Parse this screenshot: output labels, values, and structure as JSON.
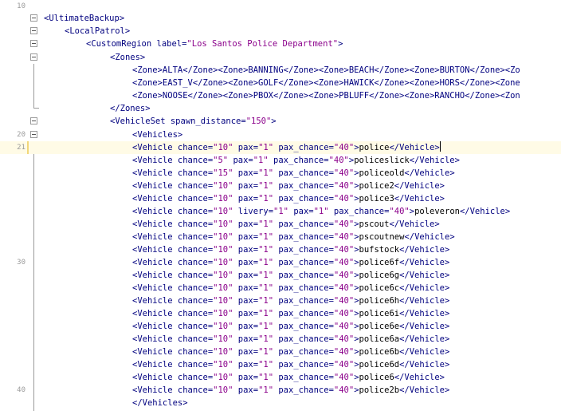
{
  "line_numbers": {
    "first": "10",
    "twenty": "20",
    "twentyone": "21",
    "thirty": "30",
    "forty": "40"
  },
  "code": {
    "l1": "<UltimateBackup>",
    "l2": "<LocalPatrol>",
    "l3_tag": "<CustomRegion label=",
    "l3_val": "\"Los Santos Police Department\"",
    "l3_end": ">",
    "l4": "<Zones>",
    "l5": "<Zone>ALTA</Zone><Zone>BANNING</Zone><Zone>BEACH</Zone><Zone>BURTON</Zone><Zo",
    "l6": "<Zone>EAST_V</Zone><Zone>GOLF</Zone><Zone>HAWICK</Zone><Zone>HORS</Zone><Zone",
    "l7": "<Zone>NOOSE</Zone><Zone>PBOX</Zone><Zone>PBLUFF</Zone><Zone>RANCHO</Zone><Zon",
    "l8": "</Zones>",
    "l9_tag": "<VehicleSet spawn_distance=",
    "l9_val": "\"150\"",
    "l9_end": ">",
    "l10": "<Vehicles>",
    "l11_close": "</Vehicles>"
  },
  "vehicles": [
    {
      "chance": "\"10\"",
      "pax": "\"1\"",
      "pax_chance": "\"40\"",
      "name": "police",
      "livery": ""
    },
    {
      "chance": "\"5\"",
      "pax": "\"1\"",
      "pax_chance": "\"40\"",
      "name": "policeslick",
      "livery": ""
    },
    {
      "chance": "\"15\"",
      "pax": "\"1\"",
      "pax_chance": "\"40\"",
      "name": "policeold",
      "livery": ""
    },
    {
      "chance": "\"10\"",
      "pax": "\"1\"",
      "pax_chance": "\"40\"",
      "name": "police2",
      "livery": ""
    },
    {
      "chance": "\"10\"",
      "pax": "\"1\"",
      "pax_chance": "\"40\"",
      "name": "police3",
      "livery": ""
    },
    {
      "chance": "\"10\"",
      "pax": "\"1\"",
      "pax_chance": "\"40\"",
      "name": "poleveron",
      "livery": "\"1\""
    },
    {
      "chance": "\"10\"",
      "pax": "\"1\"",
      "pax_chance": "\"40\"",
      "name": "pscout",
      "livery": ""
    },
    {
      "chance": "\"10\"",
      "pax": "\"1\"",
      "pax_chance": "\"40\"",
      "name": "pscoutnew",
      "livery": ""
    },
    {
      "chance": "\"10\"",
      "pax": "\"1\"",
      "pax_chance": "\"40\"",
      "name": "bufstock",
      "livery": ""
    },
    {
      "chance": "\"10\"",
      "pax": "\"1\"",
      "pax_chance": "\"40\"",
      "name": "police6f",
      "livery": ""
    },
    {
      "chance": "\"10\"",
      "pax": "\"1\"",
      "pax_chance": "\"40\"",
      "name": "police6g",
      "livery": ""
    },
    {
      "chance": "\"10\"",
      "pax": "\"1\"",
      "pax_chance": "\"40\"",
      "name": "police6c",
      "livery": ""
    },
    {
      "chance": "\"10\"",
      "pax": "\"1\"",
      "pax_chance": "\"40\"",
      "name": "police6h",
      "livery": ""
    },
    {
      "chance": "\"10\"",
      "pax": "\"1\"",
      "pax_chance": "\"40\"",
      "name": "police6i",
      "livery": ""
    },
    {
      "chance": "\"10\"",
      "pax": "\"1\"",
      "pax_chance": "\"40\"",
      "name": "police6e",
      "livery": ""
    },
    {
      "chance": "\"10\"",
      "pax": "\"1\"",
      "pax_chance": "\"40\"",
      "name": "police6a",
      "livery": ""
    },
    {
      "chance": "\"10\"",
      "pax": "\"1\"",
      "pax_chance": "\"40\"",
      "name": "police6b",
      "livery": ""
    },
    {
      "chance": "\"10\"",
      "pax": "\"1\"",
      "pax_chance": "\"40\"",
      "name": "police6d",
      "livery": ""
    },
    {
      "chance": "\"10\"",
      "pax": "\"1\"",
      "pax_chance": "\"40\"",
      "name": "police6",
      "livery": ""
    },
    {
      "chance": "\"10\"",
      "pax": "\"1\"",
      "pax_chance": "\"40\"",
      "name": "police2b",
      "livery": ""
    }
  ],
  "colors": {
    "tag": "#00007f",
    "value": "#8b008b",
    "current_line": "#fffbe6"
  }
}
